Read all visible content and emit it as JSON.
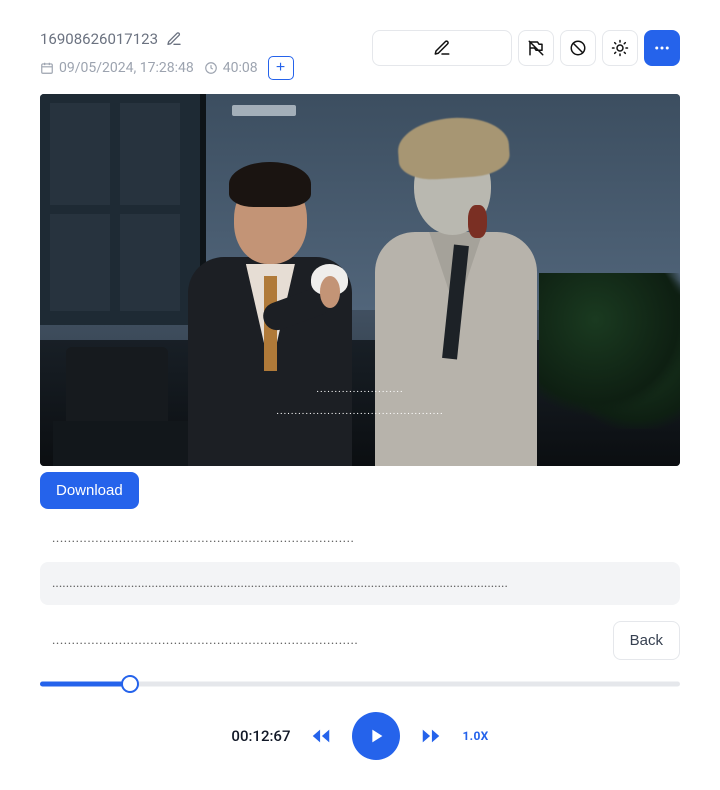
{
  "header": {
    "title": "16908626017123",
    "date": "09/05/2024, 17:28:48",
    "duration": "40:08"
  },
  "download_label": "Download",
  "back_label": "Back",
  "dots": {
    "a": "........................",
    "b": "..............................................",
    "line1": ".............................................................................",
    "line2": ".....................................................................................................................................",
    "line3": ".............................................................................."
  },
  "player": {
    "time": "00:12:67",
    "speed": "1.0X",
    "progress_percent": 14
  }
}
